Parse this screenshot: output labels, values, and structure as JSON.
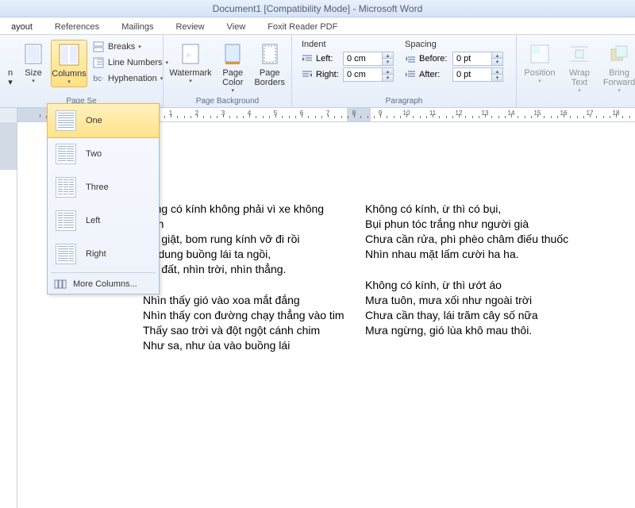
{
  "titlebar": "Document1 [Compatibility Mode] - Microsoft Word",
  "tabs": [
    "ayout",
    "References",
    "Mailings",
    "Review",
    "View",
    "Foxit Reader PDF"
  ],
  "ribbon": {
    "page_setup": {
      "label": "Page Se",
      "size": "Size",
      "columns": "Columns",
      "breaks": "Breaks",
      "line_numbers": "Line Numbers",
      "hyphenation": "Hyphenation"
    },
    "page_background": {
      "label": "Page Background",
      "watermark": "Watermark",
      "page_color": "Page\nColor",
      "page_borders": "Page\nBorders"
    },
    "paragraph": {
      "label": "Paragraph",
      "indent": "Indent",
      "spacing": "Spacing",
      "left_label": "Left:",
      "right_label": "Right:",
      "before_label": "Before:",
      "after_label": "After:",
      "left_val": "0 cm",
      "right_val": "0 cm",
      "before_val": "0 pt",
      "after_val": "0 pt"
    },
    "arrange": {
      "position": "Position",
      "wrap": "Wrap\nText",
      "bring": "Bring\nForward"
    }
  },
  "columns_dropdown": {
    "one": "One",
    "two": "Two",
    "three": "Three",
    "left": "Left",
    "right": "Right",
    "more": "More Columns..."
  },
  "doc": {
    "col1_s1": [
      "hông có kính không phải vì xe không",
      " kính",
      "om giật, bom rung kính vỡ đi rồi",
      "ng dung buồng lái ta ngồi,",
      "hìn đất, nhìn trời, nhìn thẳng."
    ],
    "col1_s2": [
      "Nhìn thấy gió vào xoa mắt đắng",
      "Nhìn thấy con đường chạy thẳng vào tim",
      "Thấy sao trời và đột ngột cánh chim",
      "Như sa, như ùa vào buồng lái"
    ],
    "col2_s1": [
      "Không có kính, ừ thì có bụi,",
      "Bụi phun tóc trắng như người già",
      "Chưa cần rửa, phì phèo châm điếu thuốc",
      "Nhìn nhau mặt lấm cười ha ha."
    ],
    "col2_s2": [
      "Không có kính, ừ thì ướt áo",
      "Mưa tuôn, mưa xối như ngoài trời",
      "Chưa cần thay, lái trăm cây số nữa",
      "Mưa ngừng, gió lùa khô mau thôi."
    ]
  }
}
